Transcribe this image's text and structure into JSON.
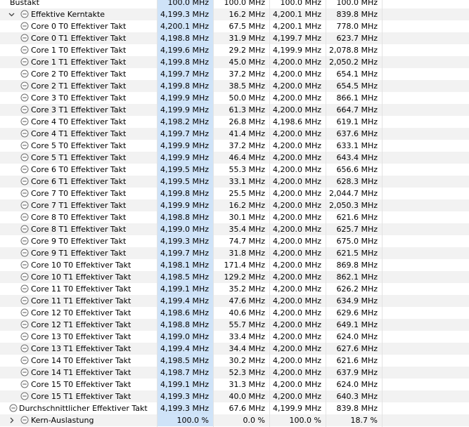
{
  "rows": [
    {
      "label": "Bustakt",
      "indent": 0,
      "chevron": "",
      "icon": false,
      "values": [
        "100.0 MHz",
        "100.0 MHz",
        "100.0 MHz",
        "100.0 MHz"
      ]
    },
    {
      "label": "Effektive Kerntakte",
      "indent": 1,
      "chevron": "expanded",
      "icon": true,
      "values": [
        "4,199.3 MHz",
        "16.2 MHz",
        "4,200.1 MHz",
        "839.8 MHz"
      ]
    },
    {
      "label": "Core 0 T0 Effektiver Takt",
      "indent": 2,
      "chevron": "",
      "icon": true,
      "values": [
        "4,200.1 MHz",
        "67.5 MHz",
        "4,200.1 MHz",
        "778.0 MHz"
      ]
    },
    {
      "label": "Core 0 T1 Effektiver Takt",
      "indent": 2,
      "chevron": "",
      "icon": true,
      "values": [
        "4,198.8 MHz",
        "31.9 MHz",
        "4,199.7 MHz",
        "623.7 MHz"
      ]
    },
    {
      "label": "Core 1 T0 Effektiver Takt",
      "indent": 2,
      "chevron": "",
      "icon": true,
      "values": [
        "4,199.6 MHz",
        "29.2 MHz",
        "4,199.9 MHz",
        "2,078.8 MHz"
      ]
    },
    {
      "label": "Core 1 T1 Effektiver Takt",
      "indent": 2,
      "chevron": "",
      "icon": true,
      "values": [
        "4,199.8 MHz",
        "45.0 MHz",
        "4,200.0 MHz",
        "2,050.2 MHz"
      ]
    },
    {
      "label": "Core 2 T0 Effektiver Takt",
      "indent": 2,
      "chevron": "",
      "icon": true,
      "values": [
        "4,199.7 MHz",
        "37.2 MHz",
        "4,200.0 MHz",
        "654.1 MHz"
      ]
    },
    {
      "label": "Core 2 T1 Effektiver Takt",
      "indent": 2,
      "chevron": "",
      "icon": true,
      "values": [
        "4,199.8 MHz",
        "38.5 MHz",
        "4,200.0 MHz",
        "654.5 MHz"
      ]
    },
    {
      "label": "Core 3 T0 Effektiver Takt",
      "indent": 2,
      "chevron": "",
      "icon": true,
      "values": [
        "4,199.9 MHz",
        "50.0 MHz",
        "4,200.0 MHz",
        "866.1 MHz"
      ]
    },
    {
      "label": "Core 3 T1 Effektiver Takt",
      "indent": 2,
      "chevron": "",
      "icon": true,
      "values": [
        "4,199.9 MHz",
        "61.3 MHz",
        "4,200.0 MHz",
        "664.7 MHz"
      ]
    },
    {
      "label": "Core 4 T0 Effektiver Takt",
      "indent": 2,
      "chevron": "",
      "icon": true,
      "values": [
        "4,198.2 MHz",
        "26.8 MHz",
        "4,198.6 MHz",
        "619.1 MHz"
      ]
    },
    {
      "label": "Core 4 T1 Effektiver Takt",
      "indent": 2,
      "chevron": "",
      "icon": true,
      "values": [
        "4,199.7 MHz",
        "41.4 MHz",
        "4,200.0 MHz",
        "637.6 MHz"
      ]
    },
    {
      "label": "Core 5 T0 Effektiver Takt",
      "indent": 2,
      "chevron": "",
      "icon": true,
      "values": [
        "4,199.9 MHz",
        "37.2 MHz",
        "4,200.0 MHz",
        "633.1 MHz"
      ]
    },
    {
      "label": "Core 5 T1 Effektiver Takt",
      "indent": 2,
      "chevron": "",
      "icon": true,
      "values": [
        "4,199.9 MHz",
        "46.4 MHz",
        "4,200.0 MHz",
        "643.4 MHz"
      ]
    },
    {
      "label": "Core 6 T0 Effektiver Takt",
      "indent": 2,
      "chevron": "",
      "icon": true,
      "values": [
        "4,199.5 MHz",
        "55.3 MHz",
        "4,200.0 MHz",
        "656.6 MHz"
      ]
    },
    {
      "label": "Core 6 T1 Effektiver Takt",
      "indent": 2,
      "chevron": "",
      "icon": true,
      "values": [
        "4,199.5 MHz",
        "33.1 MHz",
        "4,200.0 MHz",
        "628.3 MHz"
      ]
    },
    {
      "label": "Core 7 T0 Effektiver Takt",
      "indent": 2,
      "chevron": "",
      "icon": true,
      "values": [
        "4,199.8 MHz",
        "25.5 MHz",
        "4,200.0 MHz",
        "2,044.7 MHz"
      ]
    },
    {
      "label": "Core 7 T1 Effektiver Takt",
      "indent": 2,
      "chevron": "",
      "icon": true,
      "values": [
        "4,199.9 MHz",
        "16.2 MHz",
        "4,200.0 MHz",
        "2,050.3 MHz"
      ]
    },
    {
      "label": "Core 8 T0 Effektiver Takt",
      "indent": 2,
      "chevron": "",
      "icon": true,
      "values": [
        "4,198.8 MHz",
        "30.1 MHz",
        "4,200.0 MHz",
        "621.6 MHz"
      ]
    },
    {
      "label": "Core 8 T1 Effektiver Takt",
      "indent": 2,
      "chevron": "",
      "icon": true,
      "values": [
        "4,199.0 MHz",
        "35.4 MHz",
        "4,200.0 MHz",
        "625.7 MHz"
      ]
    },
    {
      "label": "Core 9 T0 Effektiver Takt",
      "indent": 2,
      "chevron": "",
      "icon": true,
      "values": [
        "4,199.3 MHz",
        "74.7 MHz",
        "4,200.0 MHz",
        "675.0 MHz"
      ]
    },
    {
      "label": "Core 9 T1 Effektiver Takt",
      "indent": 2,
      "chevron": "",
      "icon": true,
      "values": [
        "4,199.7 MHz",
        "31.8 MHz",
        "4,200.0 MHz",
        "621.5 MHz"
      ]
    },
    {
      "label": "Core 10 T0 Effektiver Takt",
      "indent": 2,
      "chevron": "",
      "icon": true,
      "values": [
        "4,198.1 MHz",
        "171.4 MHz",
        "4,200.0 MHz",
        "869.8 MHz"
      ]
    },
    {
      "label": "Core 10 T1 Effektiver Takt",
      "indent": 2,
      "chevron": "",
      "icon": true,
      "values": [
        "4,198.5 MHz",
        "129.2 MHz",
        "4,200.0 MHz",
        "862.1 MHz"
      ]
    },
    {
      "label": "Core 11 T0 Effektiver Takt",
      "indent": 2,
      "chevron": "",
      "icon": true,
      "values": [
        "4,199.1 MHz",
        "35.2 MHz",
        "4,200.0 MHz",
        "626.2 MHz"
      ]
    },
    {
      "label": "Core 11 T1 Effektiver Takt",
      "indent": 2,
      "chevron": "",
      "icon": true,
      "values": [
        "4,199.4 MHz",
        "47.6 MHz",
        "4,200.0 MHz",
        "634.9 MHz"
      ]
    },
    {
      "label": "Core 12 T0 Effektiver Takt",
      "indent": 2,
      "chevron": "",
      "icon": true,
      "values": [
        "4,198.6 MHz",
        "40.6 MHz",
        "4,200.0 MHz",
        "629.6 MHz"
      ]
    },
    {
      "label": "Core 12 T1 Effektiver Takt",
      "indent": 2,
      "chevron": "",
      "icon": true,
      "values": [
        "4,198.8 MHz",
        "55.7 MHz",
        "4,200.0 MHz",
        "649.1 MHz"
      ]
    },
    {
      "label": "Core 13 T0 Effektiver Takt",
      "indent": 2,
      "chevron": "",
      "icon": true,
      "values": [
        "4,199.0 MHz",
        "33.4 MHz",
        "4,200.0 MHz",
        "624.0 MHz"
      ]
    },
    {
      "label": "Core 13 T1 Effektiver Takt",
      "indent": 2,
      "chevron": "",
      "icon": true,
      "values": [
        "4,199.4 MHz",
        "34.4 MHz",
        "4,200.0 MHz",
        "627.6 MHz"
      ]
    },
    {
      "label": "Core 14 T0 Effektiver Takt",
      "indent": 2,
      "chevron": "",
      "icon": true,
      "values": [
        "4,198.5 MHz",
        "30.2 MHz",
        "4,200.0 MHz",
        "621.6 MHz"
      ]
    },
    {
      "label": "Core 14 T1 Effektiver Takt",
      "indent": 2,
      "chevron": "",
      "icon": true,
      "values": [
        "4,198.7 MHz",
        "52.3 MHz",
        "4,200.0 MHz",
        "637.9 MHz"
      ]
    },
    {
      "label": "Core 15 T0 Effektiver Takt",
      "indent": 2,
      "chevron": "",
      "icon": true,
      "values": [
        "4,199.1 MHz",
        "31.3 MHz",
        "4,200.0 MHz",
        "624.0 MHz"
      ]
    },
    {
      "label": "Core 15 T1 Effektiver Takt",
      "indent": 2,
      "chevron": "",
      "icon": true,
      "values": [
        "4,199.3 MHz",
        "40.0 MHz",
        "4,200.0 MHz",
        "640.3 MHz"
      ]
    },
    {
      "label": "Durchschnittlicher Effektiver Takt",
      "indent": 0,
      "chevron": "",
      "icon": true,
      "values": [
        "4,199.3 MHz",
        "67.6 MHz",
        "4,199.9 MHz",
        "839.8 MHz"
      ]
    },
    {
      "label": "Kern-Auslastung",
      "indent": 1,
      "chevron": "collapsed",
      "icon": true,
      "values": [
        "100.0 %",
        "0.0 %",
        "100.0 %",
        "18.7 %"
      ]
    }
  ],
  "icons": {
    "sensor": "sensor-circle-icon",
    "expanded": "chevron-down-icon",
    "collapsed": "chevron-right-icon"
  },
  "colors": {
    "current_column_bg": "#cfe3f8",
    "row_alt_bg": "#f2f2f2",
    "icon_stroke": "#6f6f6f"
  }
}
